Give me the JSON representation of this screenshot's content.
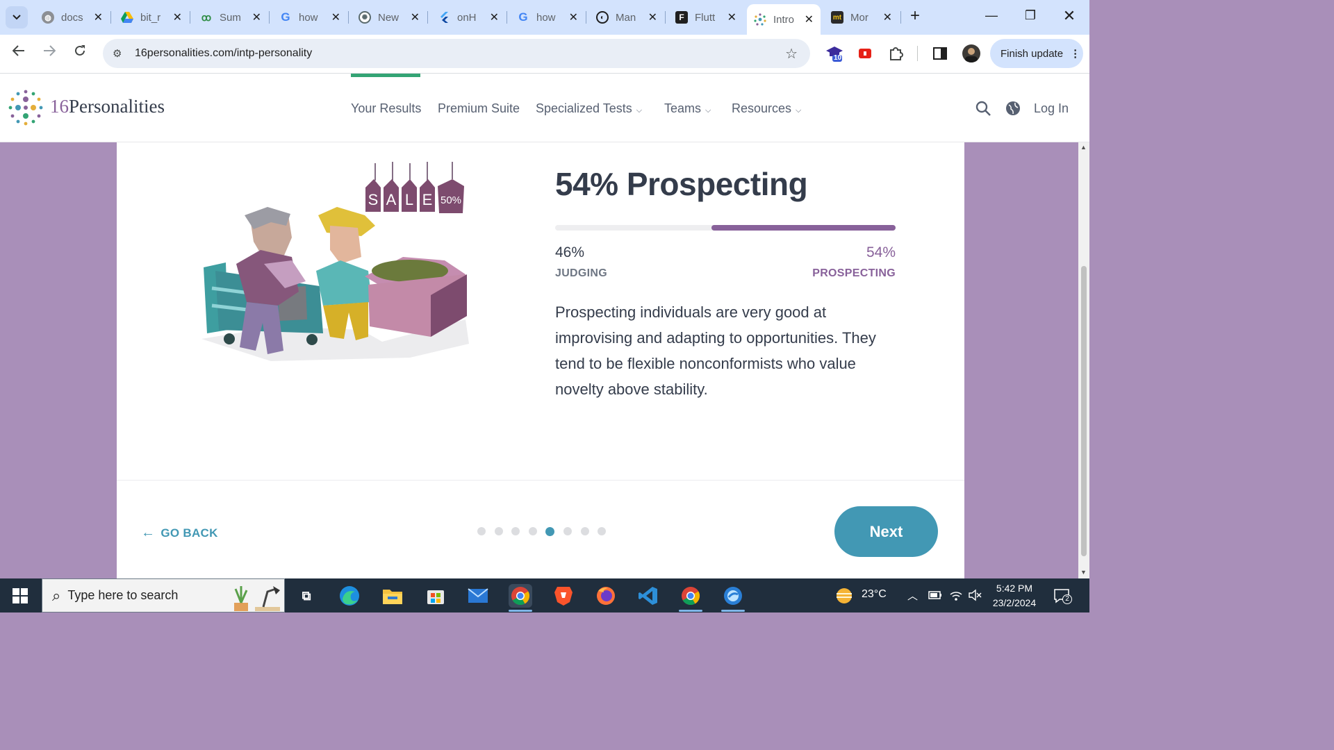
{
  "browser": {
    "tabs": [
      {
        "title": "docs",
        "icon": "globe-icon"
      },
      {
        "title": "bit_r",
        "icon": "google-drive-icon"
      },
      {
        "title": "Sum",
        "icon": "geeksforgeeks-icon"
      },
      {
        "title": "how",
        "icon": "google-icon"
      },
      {
        "title": "New",
        "icon": "chatgpt-icon"
      },
      {
        "title": "onH",
        "icon": "flutter-icon"
      },
      {
        "title": "how",
        "icon": "google-icon"
      },
      {
        "title": "Man",
        "icon": "site-icon"
      },
      {
        "title": "Flutt",
        "icon": "flutter-docs-icon"
      },
      {
        "title": "Intro",
        "icon": "16personalities-icon",
        "active": true
      },
      {
        "title": "Mor",
        "icon": "mt-icon"
      }
    ],
    "url": "16personalities.com/intp-personality",
    "finish_update_label": "Finish update",
    "extension_badge": "10"
  },
  "site": {
    "logo_number": "16",
    "logo_text": "Personalities",
    "nav": [
      "Your Results",
      "Premium Suite",
      "Specialized Tests",
      "Teams",
      "Resources"
    ],
    "login_label": "Log In"
  },
  "illustration": {
    "tags": [
      "S",
      "A",
      "L",
      "E",
      "50%"
    ]
  },
  "trait": {
    "title": "54% Prospecting",
    "left_percent": "46%",
    "left_label": "JUDGING",
    "right_percent": "54%",
    "right_label": "PROSPECTING",
    "prospecting_fraction": 0.54,
    "description": "Prospecting individuals are very good at improvising and adapting to opportunities. They tend to be flexible nonconformists who value novelty above stability.",
    "accent_color": "#88619a"
  },
  "pager": {
    "back_label": "GO BACK",
    "next_label": "Next",
    "total_steps": 8,
    "current_step": 5
  },
  "taskbar": {
    "search_placeholder": "Type here to search",
    "weather": "23°C",
    "time": "5:42 PM",
    "date": "23/2/2024",
    "notification_count": "2"
  }
}
